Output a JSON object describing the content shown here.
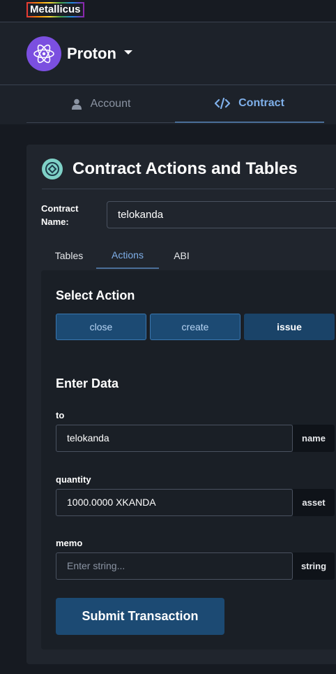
{
  "brand": {
    "label": "Metallicus"
  },
  "chain": {
    "name": "Proton"
  },
  "top_tabs": [
    {
      "label": "Account"
    },
    {
      "label": "Contract"
    }
  ],
  "card": {
    "title": "Contract Actions and Tables"
  },
  "contract": {
    "label": "Contract Name:",
    "value": "telokanda"
  },
  "sub_tabs": [
    {
      "label": "Tables"
    },
    {
      "label": "Actions"
    },
    {
      "label": "ABI"
    }
  ],
  "select_action": {
    "heading": "Select Action",
    "actions": [
      {
        "label": "close"
      },
      {
        "label": "create"
      },
      {
        "label": "issue"
      }
    ]
  },
  "enter_data": {
    "heading": "Enter Data",
    "fields": [
      {
        "label": "to",
        "value": "telokanda",
        "type": "name"
      },
      {
        "label": "quantity",
        "value": "1000.0000 XKANDA",
        "type": "asset"
      },
      {
        "label": "memo",
        "placeholder": "Enter string...",
        "type": "string"
      }
    ]
  },
  "submit": {
    "label": "Submit Transaction"
  },
  "colors": {
    "accent": "#7fb0ea",
    "button": "#1c4a73",
    "background": "#161a21"
  }
}
